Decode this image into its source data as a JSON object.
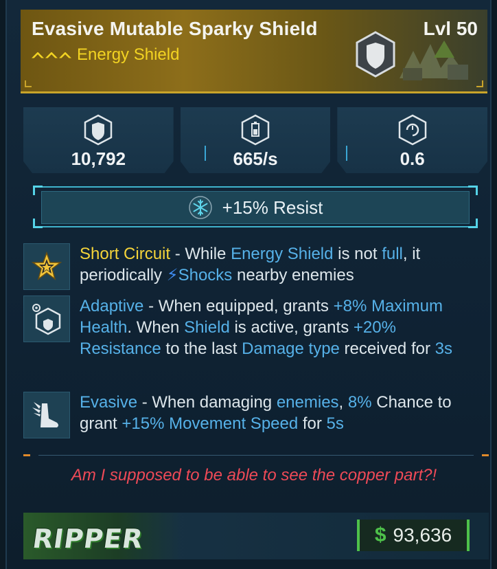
{
  "item": {
    "name": "Evasive Mutable Sparky Shield",
    "level_label": "Lvl 50",
    "type": "Energy Shield",
    "rarity_color": "#f2d322",
    "icon": "shield-icon"
  },
  "stats": [
    {
      "icon": "shield-capacity-icon",
      "value": "10,792"
    },
    {
      "icon": "recharge-rate-icon",
      "value": "665/s"
    },
    {
      "icon": "recharge-delay-icon",
      "value": "0.6"
    }
  ],
  "resist": {
    "icon": "snowflake-icon",
    "text": "+15% Resist",
    "color": "#55d3e8"
  },
  "perks": [
    {
      "icon": "star-icon",
      "segments": [
        {
          "t": "Short Circuit",
          "c": "y"
        },
        {
          "t": " - While ",
          "c": ""
        },
        {
          "t": "Energy Shield",
          "c": "b"
        },
        {
          "t": " is not ",
          "c": ""
        },
        {
          "t": "full",
          "c": "b"
        },
        {
          "t": ", it periodically ",
          "c": ""
        },
        {
          "t": "⚡",
          "c": "bolt"
        },
        {
          "t": "Shocks",
          "c": "b"
        },
        {
          "t": " nearby enemies",
          "c": ""
        }
      ]
    },
    {
      "icon": "adaptive-shield-icon",
      "segments": [
        {
          "t": "Adaptive",
          "c": "b"
        },
        {
          "t": " - When equipped, grants ",
          "c": ""
        },
        {
          "t": "+8% Maximum Health",
          "c": "b"
        },
        {
          "t": ". When ",
          "c": ""
        },
        {
          "t": "Shield",
          "c": "b"
        },
        {
          "t": " is active, grants ",
          "c": ""
        },
        {
          "t": "+20% Resistance",
          "c": "b"
        },
        {
          "t": " to the last ",
          "c": ""
        },
        {
          "t": "Damage type",
          "c": "b"
        },
        {
          "t": " received for ",
          "c": ""
        },
        {
          "t": "3s",
          "c": "b"
        }
      ]
    },
    {
      "icon": "winged-boot-icon",
      "segments": [
        {
          "t": "Evasive",
          "c": "b"
        },
        {
          "t": " - When damaging ",
          "c": ""
        },
        {
          "t": "enemies",
          "c": "b"
        },
        {
          "t": ", ",
          "c": ""
        },
        {
          "t": "8%",
          "c": "b"
        },
        {
          "t": " Chance to grant ",
          "c": ""
        },
        {
          "t": "+15% Movement Speed",
          "c": "b"
        },
        {
          "t": " for ",
          "c": ""
        },
        {
          "t": "5s",
          "c": "b"
        }
      ]
    }
  ],
  "flavor_text": "Am I supposed to be able to see the copper part?!",
  "manufacturer": "RIPPER",
  "price": {
    "symbol": "$",
    "value": "93,636",
    "color": "#4ec14a"
  }
}
